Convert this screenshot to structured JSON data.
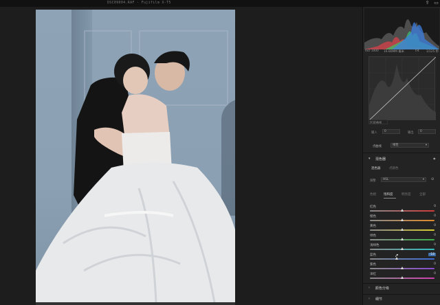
{
  "window": {
    "title": "DSC09004.RAF - Fujifilm X-T5",
    "share_icon": "share-icon",
    "window_icon": "window-icon"
  },
  "photo": {
    "subject": "photo-preview"
  },
  "histogram": {
    "iso": "ISO 1000",
    "lens": "16-80MM 毫米",
    "aperture": "f/4",
    "shutter": "1/125 秒",
    "colors": {
      "red": "#d8424a",
      "green": "#3fbf6a",
      "blue": "#3c7fe0"
    }
  },
  "curve": {
    "region_label": "区域曲线",
    "input_label": "输入",
    "input_value": "0",
    "output_label": "输出",
    "output_value": "0",
    "point_curve_label": "点曲线",
    "point_curve_value": "线性"
  },
  "mixer": {
    "title": "混色器",
    "tab_mixer": "混色器",
    "tab_color": "点颜色",
    "adjust_label": "调整",
    "adjust_value": "HSL",
    "sub_tabs": [
      "色相",
      "饱和度",
      "明亮度",
      "全部"
    ],
    "active_sub_tab": 1,
    "rows": [
      {
        "label": "红色",
        "value": "0",
        "pos": 0.5,
        "gradient": "linear-gradient(90deg,#8a8a8a,#d23a3a)"
      },
      {
        "label": "橙色",
        "value": "0",
        "pos": 0.5,
        "gradient": "linear-gradient(90deg,#8a8a8a,#e08a2a)"
      },
      {
        "label": "黄色",
        "value": "0",
        "pos": 0.5,
        "gradient": "linear-gradient(90deg,#8a8a8a,#d8cc30)"
      },
      {
        "label": "绿色",
        "value": "0",
        "pos": 0.5,
        "gradient": "linear-gradient(90deg,#8a8a8a,#3ab04a)"
      },
      {
        "label": "浅绿色",
        "value": "0",
        "pos": 0.5,
        "gradient": "linear-gradient(90deg,#8a8a8a,#30c0c0)"
      },
      {
        "label": "蓝色",
        "value": "-18",
        "pos": 0.41,
        "gradient": "linear-gradient(90deg,#8a8a8a,#3a6ad8)",
        "active": true
      },
      {
        "label": "紫色",
        "value": "0",
        "pos": 0.5,
        "gradient": "linear-gradient(90deg,#8a8a8a,#8a4ad0)"
      },
      {
        "label": "洋红",
        "value": "0",
        "pos": 0.5,
        "gradient": "linear-gradient(90deg,#8a8a8a,#d040b0)"
      }
    ]
  },
  "panels": {
    "color_grading": "颜色分级",
    "detail": "细节"
  }
}
